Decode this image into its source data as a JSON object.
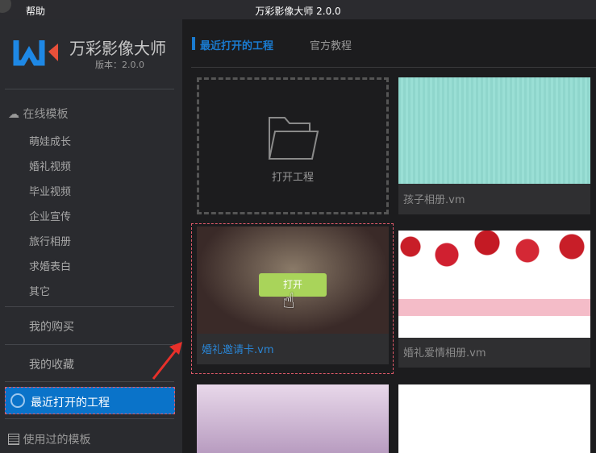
{
  "window": {
    "menu": "帮助",
    "title": "万彩影像大师 2.0.0"
  },
  "brand": {
    "name": "万彩影像大师",
    "version": "版本：2.0.0",
    "colors": {
      "accent": "#1a7bd0",
      "logo_blue": "#1e88e5",
      "logo_red": "#e8503a"
    }
  },
  "sidebar": {
    "online_templates": {
      "label": "在线模板",
      "icon": "cloud-icon",
      "items": [
        "萌娃成长",
        "婚礼视频",
        "毕业视频",
        "企业宣传",
        "旅行相册",
        "求婚表白",
        "其它"
      ]
    },
    "purchases": "我的购买",
    "favorites": "我的收藏",
    "recent": {
      "label": "最近打开的工程",
      "icon": "clock-icon",
      "selected": true
    },
    "used_templates": {
      "label": "使用过的模板",
      "icon": "list-icon"
    }
  },
  "main": {
    "tabs": [
      {
        "label": "最近打开的工程",
        "active": true
      },
      {
        "label": "官方教程",
        "active": false
      }
    ],
    "open_project": {
      "label": "打开工程",
      "icon": "folder-open-icon"
    },
    "projects": [
      {
        "name": "孩子相册.vm"
      },
      {
        "name": "婚礼邀请卡.vm",
        "hovered": true,
        "open_button": "打开"
      },
      {
        "name": "婚礼爱情相册.vm"
      }
    ]
  }
}
